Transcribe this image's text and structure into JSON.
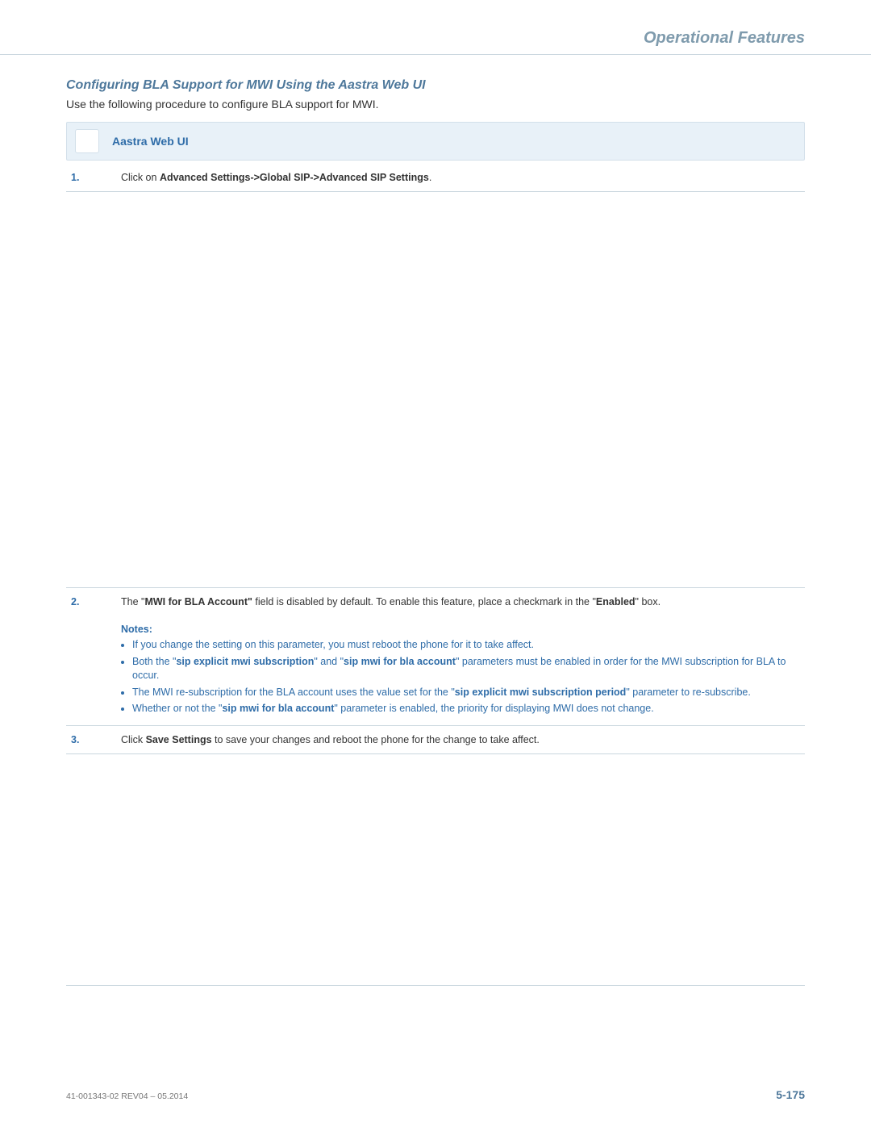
{
  "header": {
    "chapter_title": "Operational Features"
  },
  "section": {
    "title": "Configuring BLA Support for MWI Using the Aastra Web UI",
    "intro": "Use the following procedure to configure BLA support for MWI."
  },
  "callout": {
    "label": "Aastra Web UI"
  },
  "steps": {
    "s1_num": "1.",
    "s1_prefix": "Click on ",
    "s1_bold": "Advanced Settings->Global SIP->Advanced SIP Settings",
    "s1_suffix": ".",
    "s2_num": "2.",
    "s2_p1_a": "The \"",
    "s2_p1_b_bold": "MWI for BLA Account\"",
    "s2_p1_c": " field is disabled by default. To enable this feature, place a checkmark in the \"",
    "s2_p1_d_bold": "Enabled",
    "s2_p1_e": "\" box.",
    "notes_title": "Notes:",
    "note1": "If you change the setting on this parameter, you must reboot the phone for it to take affect.",
    "note2_a": "Both the \"",
    "note2_b_bold": "sip explicit mwi subscription",
    "note2_c": "\" and \"",
    "note2_d_bold": "sip mwi for bla account",
    "note2_e": "\" parameters must be enabled in order for the MWI subscription for BLA to occur.",
    "note3_a": "The MWI re-subscription for the BLA account uses the value set for the \"",
    "note3_b_bold": "sip explicit mwi subscription period",
    "note3_c": "\" parameter to re-subscribe.",
    "note4_a": "Whether or not the \"",
    "note4_b_bold": "sip mwi for bla account",
    "note4_c": "\" parameter is enabled, the priority for displaying MWI does not change.",
    "s3_num": "3.",
    "s3_a": "Click ",
    "s3_b_bold": "Save Settings",
    "s3_c": " to save your changes and reboot the phone for the change to take affect."
  },
  "footer": {
    "doc_id": "41-001343-02 REV04 – 05.2014",
    "page_num": "5-175"
  }
}
